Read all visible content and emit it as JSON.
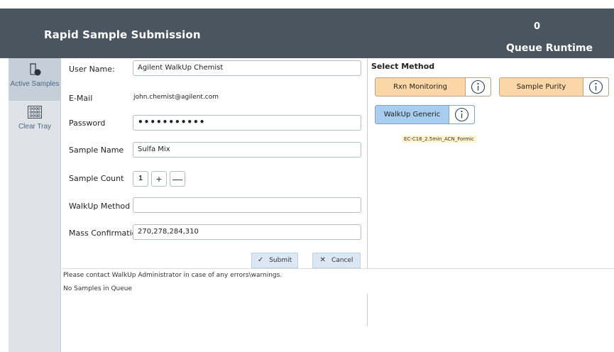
{
  "header": {
    "title": "Rapid Sample Submission",
    "queue_runtime_value": "0",
    "queue_runtime_label": "Queue Runtime"
  },
  "sidebar": {
    "items": [
      {
        "label": "Active Samples",
        "icon": "vial-icon"
      },
      {
        "label": "Clear Tray",
        "icon": "tray-grid-icon"
      }
    ]
  },
  "form": {
    "user_name_label": "User Name:",
    "user_name_value": "Agilent WalkUp Chemist",
    "email_label": "E-Mail",
    "email_value": "john.chemist@agilent.com",
    "password_label": "Password",
    "password_value": "•••••••••••",
    "sample_name_label": "Sample Name",
    "sample_name_value": "Sulfa Mix",
    "sample_count_label": "Sample Count",
    "sample_count_value": "1",
    "increment_symbol": "+",
    "decrement_symbol": "—",
    "walkup_method_label": "WalkUp Method",
    "walkup_method_value": "",
    "mass_confirmation_label": "Mass Confirmation",
    "mass_confirmation_value": "270,278,284,310",
    "submit_label": "Submit",
    "submit_symbol": "✓",
    "cancel_label": "Cancel",
    "cancel_symbol": "✕"
  },
  "methods": {
    "title": "Select Method",
    "buttons": [
      {
        "label": "Rxn Monitoring",
        "color": "#fbd6a6"
      },
      {
        "label": "Sample Purity",
        "color": "#fbd6a6"
      },
      {
        "label": "WalkUp Generic",
        "color": "#a9cdee"
      }
    ],
    "selected_description": "EC-C18_2.5min_ACN_Formic"
  },
  "footer": {
    "message": "Please contact WalkUp Administrator in case of any errors\\warnings.",
    "queue_status": "No Samples in Queue"
  },
  "colors": {
    "header_bg": "#4a5560",
    "sidebar_bg": "#dfe3e8",
    "button_bg": "#dbe7f3"
  }
}
